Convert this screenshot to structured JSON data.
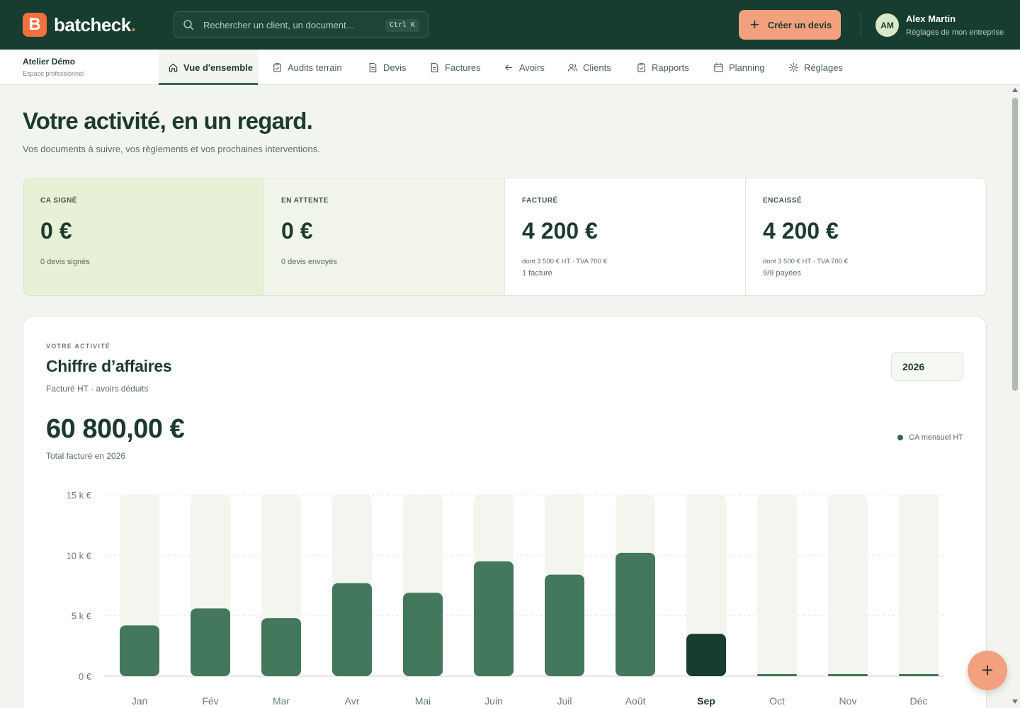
{
  "brand": {
    "logo_letter": "B",
    "name": "batcheck",
    "dot": "."
  },
  "search": {
    "placeholder": "Rechercher un client, un document…",
    "shortcut": "Ctrl K"
  },
  "cta": {
    "label": "Créer un devis",
    "plus": "+"
  },
  "user": {
    "initials": "AM",
    "name": "Alex Martin",
    "sub": "Réglages de mon entreprise"
  },
  "company": {
    "name": "Atelier Démo",
    "sub": "Espace professionnel"
  },
  "tabs": [
    {
      "label": "Vue d'ensemble",
      "icon": "home-icon"
    },
    {
      "label": "Audits terrain",
      "icon": "clipboard-icon"
    },
    {
      "label": "Devis",
      "icon": "document-icon"
    },
    {
      "label": "Factures",
      "icon": "document-icon"
    },
    {
      "label": "Avoirs",
      "icon": "arrow-left-icon"
    },
    {
      "label": "Clients",
      "icon": "users-icon"
    },
    {
      "label": "Rapports",
      "icon": "clipboard-icon"
    },
    {
      "label": "Planning",
      "icon": "calendar-icon"
    },
    {
      "label": "Réglages",
      "icon": "gear-icon"
    }
  ],
  "page": {
    "title": "Votre activité, en un regard.",
    "subtitle": "Vos documents à suivre, vos règlements et vos prochaines interventions."
  },
  "stats": [
    {
      "label": "CA SIGNÉ",
      "value": "0 €",
      "line1": "0 devis signés",
      "line2": ""
    },
    {
      "label": "EN ATTENTE",
      "value": "0 €",
      "line1": "0 devis envoyés",
      "line2": ""
    },
    {
      "label": "FACTURÉ",
      "value": "4 200 €",
      "line1": "dont 3 500 € HT · TVA 700 €",
      "line2": "1 facture"
    },
    {
      "label": "ENCAISSÉ",
      "value": "4 200 €",
      "line1": "dont 3 500 € HT · TVA 700 €",
      "line2": "9/9 payées"
    }
  ],
  "activity": {
    "eyebrow": "VOTRE ACTIVITÉ",
    "title": "Chiffre d’affaires",
    "subtitle": "Facturé HT · avoirs déduits",
    "year": "2026",
    "total": "60 800,00 €",
    "total_sub": "Total facturé en 2026"
  },
  "colors": {
    "bar": "#43785c",
    "bar_current": "#173d31",
    "bar_track": "#f3f6ef",
    "accent": "#f2a07e",
    "brand": "#173d31"
  },
  "fab": {
    "label": "+"
  },
  "chart_data": {
    "type": "bar",
    "categories": [
      "Jan",
      "Fév",
      "Mar",
      "Avr",
      "Mai",
      "Juin",
      "Juil",
      "Août",
      "Sep",
      "Oct",
      "Nov",
      "Déc"
    ],
    "series": [
      {
        "name": "CA mensuel HT",
        "values": [
          4200,
          5600,
          4800,
          7700,
          6900,
          9500,
          8400,
          10200,
          3500,
          0,
          0,
          0
        ]
      }
    ],
    "highlight_category": "Sep",
    "yticks": [
      0,
      5000,
      10000,
      15000
    ],
    "ytick_labels": [
      "0 €",
      "5 k €",
      "10 k €",
      "15 k €"
    ],
    "ylim": [
      0,
      15000
    ],
    "legend": "top-right",
    "grid": true
  }
}
